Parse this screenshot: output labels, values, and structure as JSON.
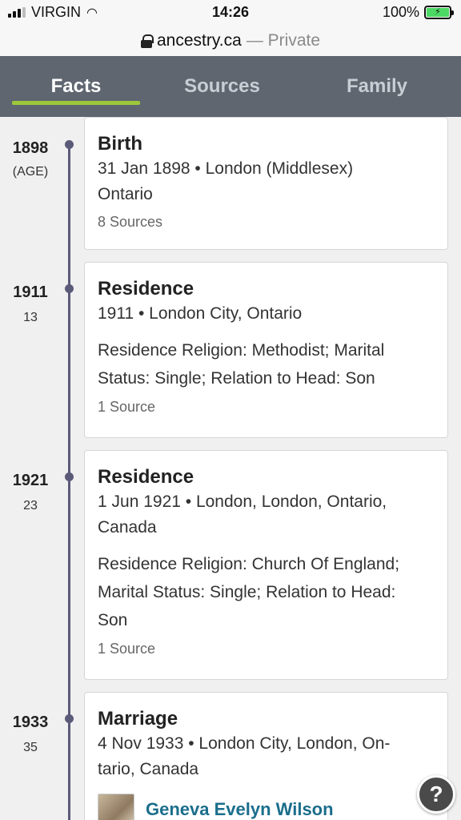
{
  "status_bar": {
    "carrier": "VIRGIN",
    "time": "14:26",
    "battery_percent": "100%",
    "battery_charging": true
  },
  "address_bar": {
    "domain": "ancestry.ca",
    "suffix": "— Private"
  },
  "tabs": [
    {
      "label": "Facts",
      "active": true
    },
    {
      "label": "Sources",
      "active": false
    },
    {
      "label": "Family",
      "active": false
    }
  ],
  "timeline": [
    {
      "year": "1898",
      "age": "(AGE)",
      "title": "Birth",
      "lines": [
        "31 Jan 1898 • London (Middlesex)",
        "Ontario"
      ],
      "description": "",
      "sources": "8 Sources"
    },
    {
      "year": "1911",
      "age": "13",
      "title": "Residence",
      "lines": [
        "1911 • London City, Ontario"
      ],
      "description_lines": [
        "Residence Religion: Methodist; Marital",
        "Status: Single; Relation to Head: Son"
      ],
      "sources": "1 Source"
    },
    {
      "year": "1921",
      "age": "23",
      "title": "Residence",
      "lines": [
        "1 Jun 1921 • London, London, Ontario,",
        "Canada"
      ],
      "description_lines": [
        "Residence Religion: Church Of England;",
        "Marital Status: Single; Relation to Head:",
        "Son"
      ],
      "sources": "1 Source"
    },
    {
      "year": "1933",
      "age": "35",
      "title": "Marriage",
      "lines": [
        "4 Nov 1933 • London City, London, On-",
        "tario, Canada"
      ],
      "spouse_name": "Geneva Evelyn Wilson"
    }
  ],
  "help_button": {
    "label": "?"
  },
  "colors": {
    "tab_bar": "#5f6670",
    "tab_indicator": "#9cc93b",
    "timeline": "#5b5a79",
    "link": "#1b6e8c"
  }
}
